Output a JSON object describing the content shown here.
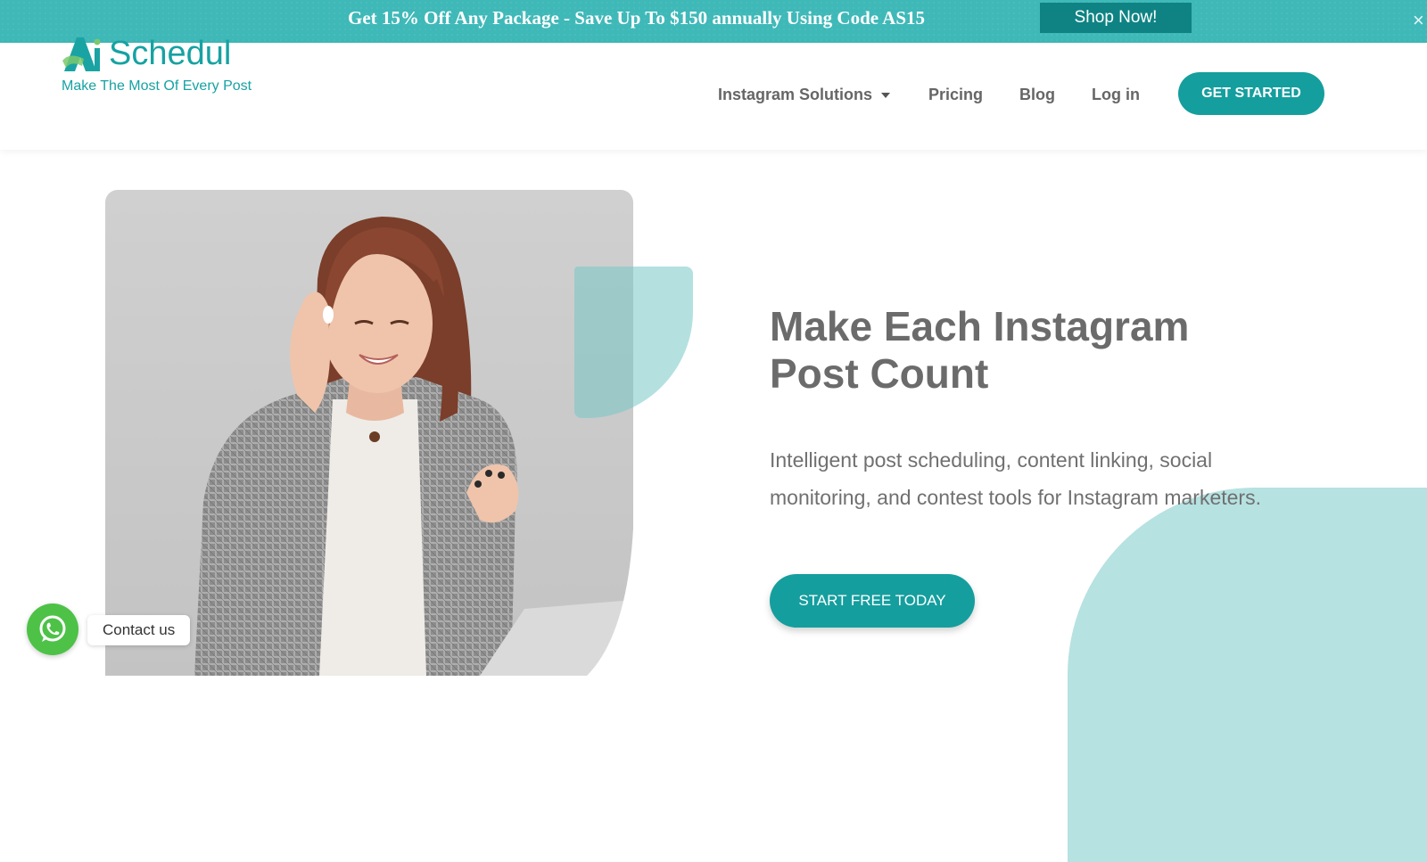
{
  "colors": {
    "brand_teal": "#159e9e",
    "banner_bg": "#3fb8b8",
    "banner_button": "#0f8383",
    "accent_light": "#b6e2e1",
    "whatsapp_green": "#4dc247"
  },
  "promo_banner": {
    "text": "Get 15% Off Any Package - Save Up To $150 annually Using Code AS15",
    "button_label": "Shop Now!",
    "close_icon": "close-icon"
  },
  "header": {
    "logo_name": "Schedul",
    "logo_mark_letters": "Ai",
    "logo_tagline": "Make The Most Of Every Post",
    "nav": {
      "solutions": "Instagram Solutions",
      "pricing": "Pricing",
      "blog": "Blog",
      "login": "Log in"
    },
    "cta_label": "GET STARTED"
  },
  "hero": {
    "title": "Make Each Instagram Post Count",
    "subtitle": "Intelligent post scheduling, content linking, social monitoring, and contest tools for Instagram marketers.",
    "cta_label": "START FREE TODAY",
    "photo_icon": "woman-with-earbuds-photo"
  },
  "contact_widget": {
    "label": "Contact us",
    "icon": "whatsapp-icon"
  }
}
